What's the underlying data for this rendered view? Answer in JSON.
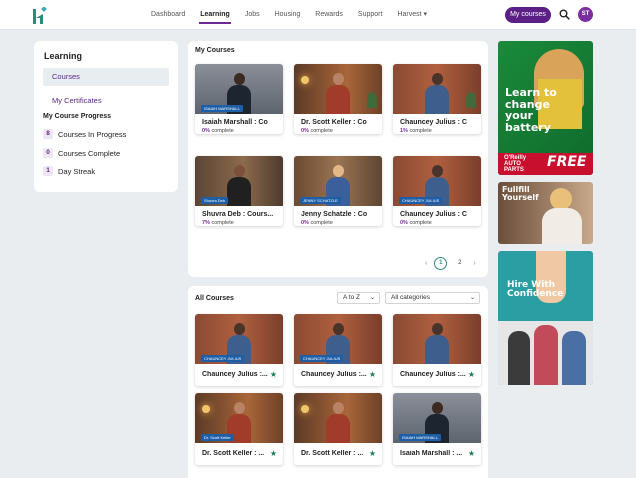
{
  "nav": {
    "items": [
      "Dashboard",
      "Learning",
      "Jobs",
      "Housing",
      "Rewards",
      "Support",
      "Harvest ▾"
    ],
    "active": "Learning",
    "my_courses_label": "My courses",
    "avatar_initials": "ST"
  },
  "sidebar": {
    "title": "Learning",
    "courses_label": "Courses",
    "certificates_label": "My Certificates",
    "progress_title": "My Course Progress",
    "stats": [
      {
        "count": "8",
        "label": "Courses In Progress"
      },
      {
        "count": "0",
        "label": "Courses Complete"
      },
      {
        "count": "1",
        "label": "Day Streak"
      }
    ]
  },
  "my_courses": {
    "title": "My Courses",
    "cards": [
      {
        "title": "Isaiah Marshall : Co",
        "pct": "0%",
        "pct_suffix": " complete",
        "tag": "ISAIAH MARSHALL"
      },
      {
        "title": "Dr. Scott Keller : Co",
        "pct": "0%",
        "pct_suffix": " complete",
        "tag": ""
      },
      {
        "title": "Chauncey Julius : C",
        "pct": "1%",
        "pct_suffix": " complete",
        "tag": ""
      },
      {
        "title": "Shuvra Deb : Cours...",
        "pct": "7%",
        "pct_suffix": " complete",
        "tag": "Shuvra Deb"
      },
      {
        "title": "Jenny Schatzle : Co",
        "pct": "0%",
        "pct_suffix": " complete",
        "tag": "JENNY SCHATZLE"
      },
      {
        "title": "Chauncey Julius : C",
        "pct": "0%",
        "pct_suffix": " complete",
        "tag": "CHAUNCEY JULIUS"
      }
    ],
    "pagination": {
      "prev": "‹",
      "pages": [
        "1",
        "2"
      ],
      "current": "1",
      "next": "›"
    }
  },
  "all_courses": {
    "title": "All Courses",
    "sort_value": "A to Z",
    "category_value": "All categories",
    "cards": [
      {
        "title": "Chauncey Julius :...",
        "tag": "CHAUNCEY JULIUS"
      },
      {
        "title": "Chauncey Julius :...",
        "tag": "CHAUNCEY JULIUS"
      },
      {
        "title": "Chauncey Julius :...",
        "tag": ""
      },
      {
        "title": "Dr. Scott Keller : ...",
        "tag": "Dr. Scott Keller"
      },
      {
        "title": "Dr. Scott Keller : ...",
        "tag": ""
      },
      {
        "title": "Isaiah Marshall : ...",
        "tag": "ISAIAH MARSHALL"
      }
    ]
  },
  "ads": [
    {
      "text": "Learn to change your battery",
      "brand": "O'Reilly AUTO PARTS",
      "cta": "FREE"
    },
    {
      "text": "Fullfill Yourself"
    },
    {
      "text": "Hire With Confidence"
    }
  ],
  "colors": {
    "brand_purple": "#5c1f86",
    "accent_green": "#2e8b78",
    "star_green": "#1e7d4f",
    "ad_green": "#1a8a3a",
    "ad_teal": "#2a9ea3"
  }
}
